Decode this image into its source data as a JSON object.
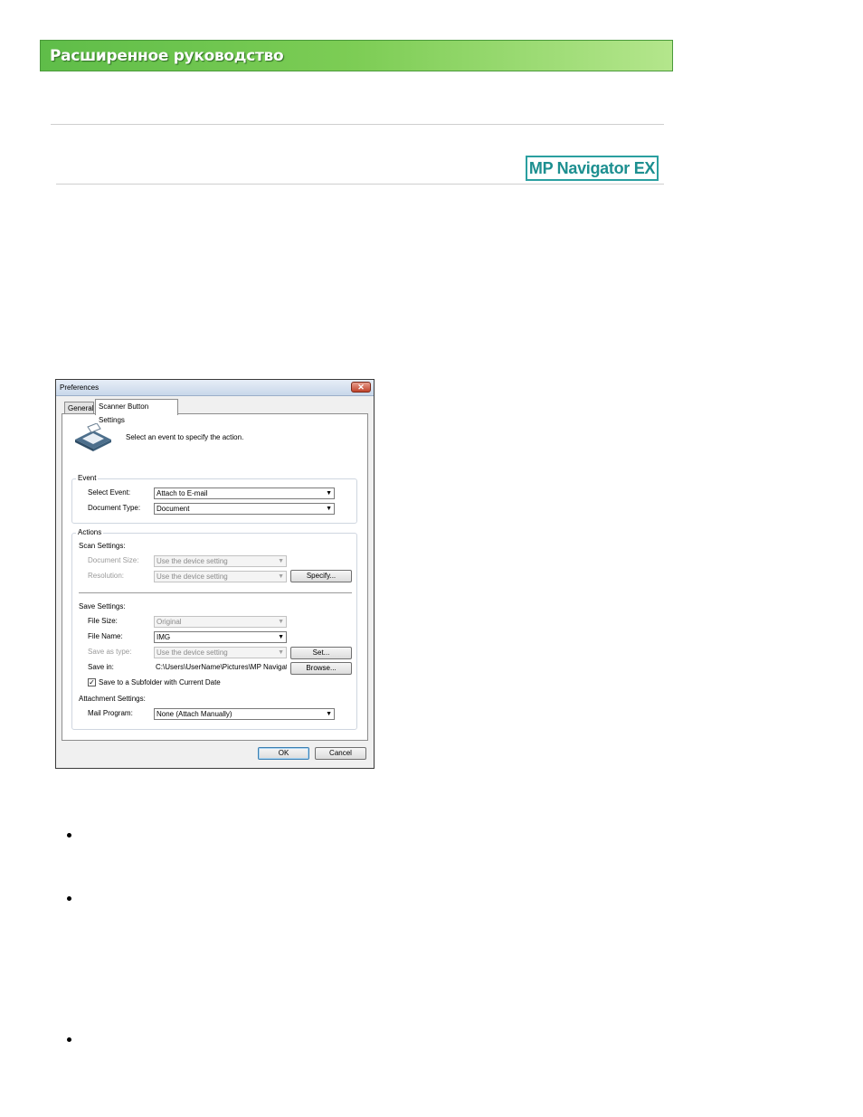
{
  "banner": {
    "title": "Расширенное руководство"
  },
  "product_logo": "MP Navigator EX",
  "dialog": {
    "title": "Preferences",
    "close_glyph": "✕",
    "tabs": [
      {
        "label": "General"
      },
      {
        "label": "Scanner Button Settings"
      }
    ],
    "instruction": "Select an event to specify the action.",
    "event_group": {
      "title": "Event",
      "select_event_label": "Select Event:",
      "select_event_value": "Attach to E-mail",
      "document_type_label": "Document Type:",
      "document_type_value": "Document"
    },
    "actions_group": {
      "title": "Actions",
      "scan_settings_label": "Scan Settings:",
      "document_size_label": "Document Size:",
      "document_size_value": "Use the device setting",
      "resolution_label": "Resolution:",
      "resolution_value": "Use the device setting",
      "specify_button": "Specify...",
      "save_settings_label": "Save Settings:",
      "file_size_label": "File Size:",
      "file_size_value": "Original",
      "file_name_label": "File Name:",
      "file_name_value": "IMG",
      "save_as_type_label": "Save as type:",
      "save_as_type_value": "Use the device setting",
      "set_button": "Set...",
      "save_in_label": "Save in:",
      "save_in_value": "C:\\Users\\UserName\\Pictures\\MP Navigato",
      "browse_button": "Browse...",
      "subfolder_checkbox_label": "Save to a Subfolder with Current Date",
      "subfolder_checked": true,
      "attachment_settings_label": "Attachment Settings:",
      "mail_program_label": "Mail Program:",
      "mail_program_value": "None (Attach Manually)"
    },
    "ok_button": "OK",
    "cancel_button": "Cancel"
  },
  "bullets": [
    {
      "text": ""
    },
    {
      "text": ""
    },
    {
      "text": ""
    }
  ]
}
